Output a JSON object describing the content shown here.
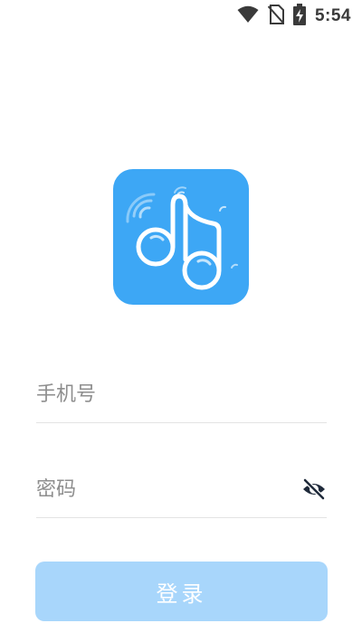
{
  "status_bar": {
    "time": "5:54",
    "icons": [
      "wifi-icon",
      "no-sim-icon",
      "battery-charging-icon"
    ]
  },
  "logo": {
    "background_color": "#3da7f5",
    "icon": "music-note-wireless-icon"
  },
  "form": {
    "phone_placeholder": "手机号",
    "phone_value": "",
    "password_placeholder": "密码",
    "password_value": "",
    "password_toggle_icon": "eye-off-icon"
  },
  "login_button": {
    "label": "登录",
    "background_color": "#a8d6fb"
  }
}
